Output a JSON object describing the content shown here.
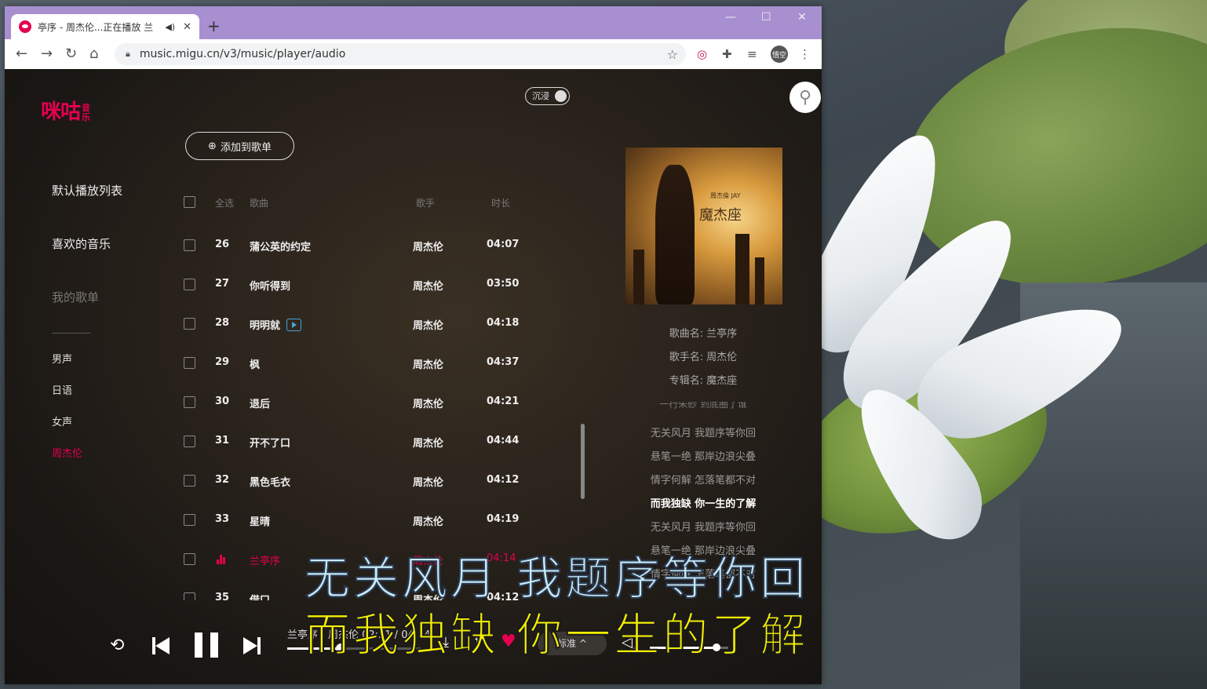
{
  "browser": {
    "tab": {
      "title": "亭序 - 周杰伦...正在播放 兰",
      "speaker_icon": "speaker-icon",
      "close": "✕"
    },
    "new_tab": "+",
    "window_controls": {
      "minimize": "—",
      "maximize": "☐",
      "close": "✕"
    },
    "nav": {
      "back": "←",
      "forward": "→",
      "reload": "↻",
      "home": "⌂"
    },
    "url": "music.migu.cn/v3/music/player/audio",
    "lock": "🔒",
    "bookmark": "☆",
    "extensions": [
      "extension-icon",
      "puzzle-icon",
      "reading-list-icon"
    ],
    "profile": "悟空",
    "menu": "⋮"
  },
  "player": {
    "logo": {
      "main": "咪咕",
      "sub": "音乐"
    },
    "immersive_toggle": "沉浸",
    "add_to_playlist": "添加到歌单",
    "sidebar": {
      "items": [
        {
          "label": "默认播放列表"
        },
        {
          "label": "喜欢的音乐"
        },
        {
          "label": "我的歌单"
        }
      ],
      "subitems": [
        {
          "label": "男声"
        },
        {
          "label": "日语"
        },
        {
          "label": "女声"
        },
        {
          "label": "周杰伦"
        }
      ]
    },
    "list_header": {
      "select_all": "全选",
      "song": "歌曲",
      "artist": "歌手",
      "duration": "时长"
    },
    "rows": [
      {
        "num": "26",
        "song": "蒲公英的约定",
        "artist": "周杰伦",
        "dur": "04:07"
      },
      {
        "num": "27",
        "song": "你听得到",
        "artist": "周杰伦",
        "dur": "03:50"
      },
      {
        "num": "28",
        "song": "明明就",
        "artist": "周杰伦",
        "dur": "04:18"
      },
      {
        "num": "29",
        "song": "枫",
        "artist": "周杰伦",
        "dur": "04:37"
      },
      {
        "num": "30",
        "song": "退后",
        "artist": "周杰伦",
        "dur": "04:21"
      },
      {
        "num": "31",
        "song": "开不了口",
        "artist": "周杰伦",
        "dur": "04:44"
      },
      {
        "num": "32",
        "song": "黑色毛衣",
        "artist": "周杰伦",
        "dur": "04:12"
      },
      {
        "num": "33",
        "song": "星晴",
        "artist": "周杰伦",
        "dur": "04:19"
      },
      {
        "num": "",
        "song": "兰亭序",
        "artist": "周杰伦",
        "dur": "04:14"
      },
      {
        "num": "35",
        "song": "借口",
        "artist": "周杰伦",
        "dur": "04:12"
      }
    ],
    "album": {
      "cover_artist": "周杰倫 JAY",
      "cover_title": "魔杰座"
    },
    "song_info": {
      "song": "歌曲名: 兰亭序",
      "artist": "歌手名: 周杰伦",
      "album": "专辑名: 魔杰座"
    },
    "lyrics": [
      "一行朱砂 到底圈了谁",
      "无关风月 我题序等你回",
      "悬笔一绝 那岸边浪尖叠",
      "情字何解 怎落笔都不对",
      "而我独缺 你一生的了解",
      "无关风月 我题序等你回",
      "悬笔一绝 那岸边浪尖叠",
      "情字何解 怎落笔都不对"
    ],
    "controls": {
      "loop": "⟲",
      "now_playing": "兰亭序 - 周杰伦  02:31 / 04:14",
      "progress": 0.4,
      "download": "⤓",
      "share": "⇪",
      "heart": "♥",
      "quality": "标准 ^",
      "volume_icon": "🔈",
      "volume": 0.85
    }
  },
  "subtitles": {
    "line1": "无关风月  我题序等你回",
    "line2": "而我独缺  你一生的了解"
  },
  "colors": {
    "accent": "#e5004f",
    "tabbar": "#a88fd0",
    "subtitle_yellow": "#f5f000",
    "subtitle_blue": "#c9eaf5"
  }
}
